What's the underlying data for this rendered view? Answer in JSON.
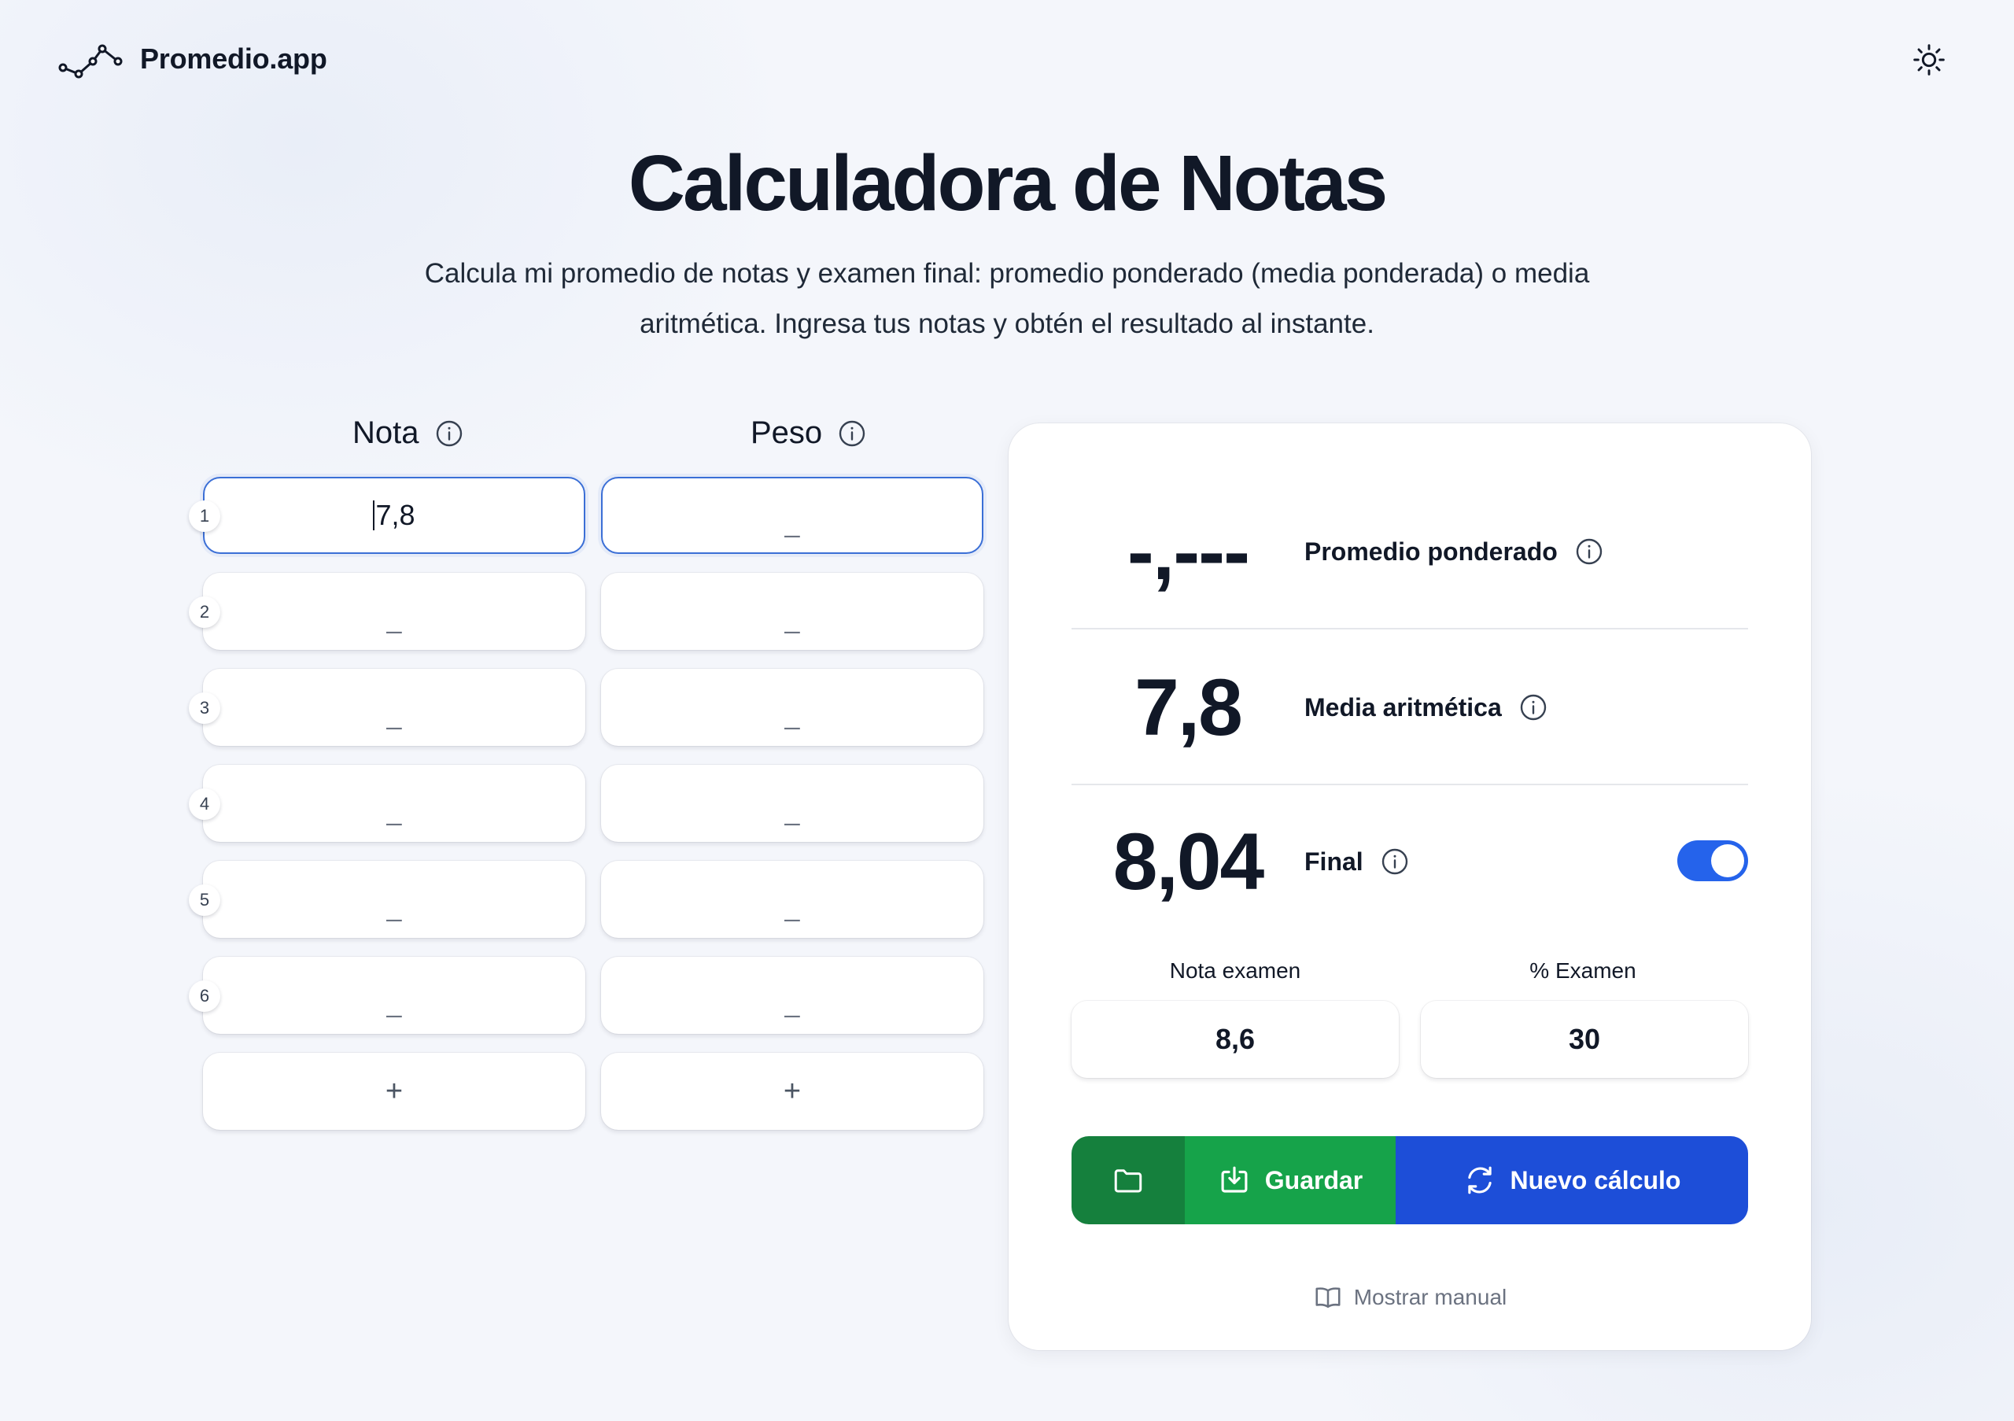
{
  "header": {
    "brand": "Promedio.app",
    "theme_toggle_icon": "sun-icon"
  },
  "hero": {
    "title": "Calculadora de Notas",
    "subtitle_line1": "Calcula mi promedio de notas y examen final: promedio ponderado (media ponderada) o media",
    "subtitle_line2": "aritmética. Ingresa tus notas y obtén el resultado al instante."
  },
  "grades": {
    "nota_header": "Nota",
    "peso_header": "Peso",
    "placeholder": "_",
    "add_label": "+",
    "rows": [
      {
        "num": "1",
        "nota": "7,8",
        "peso": ""
      },
      {
        "num": "2",
        "nota": "",
        "peso": ""
      },
      {
        "num": "3",
        "nota": "",
        "peso": ""
      },
      {
        "num": "4",
        "nota": "",
        "peso": ""
      },
      {
        "num": "5",
        "nota": "",
        "peso": ""
      },
      {
        "num": "6",
        "nota": "",
        "peso": ""
      }
    ]
  },
  "results": {
    "weighted": {
      "value": "-,---",
      "label": "Promedio ponderado"
    },
    "arithmetic": {
      "value": "7,8",
      "label": "Media aritmética"
    },
    "final": {
      "value": "8,04",
      "label": "Final",
      "toggle_on": true
    },
    "exam_grade_label": "Nota examen",
    "exam_grade_value": "8,6",
    "exam_pct_label": "% Examen",
    "exam_pct_value": "30",
    "save_label": "Guardar",
    "new_label": "Nuevo cálculo",
    "manual_label": "Mostrar manual"
  },
  "colors": {
    "accent_blue": "#1d4ed8",
    "toggle_blue": "#2563eb",
    "save_green": "#16a34a",
    "folder_green": "#15803d",
    "active_border": "#3b6fd6"
  }
}
